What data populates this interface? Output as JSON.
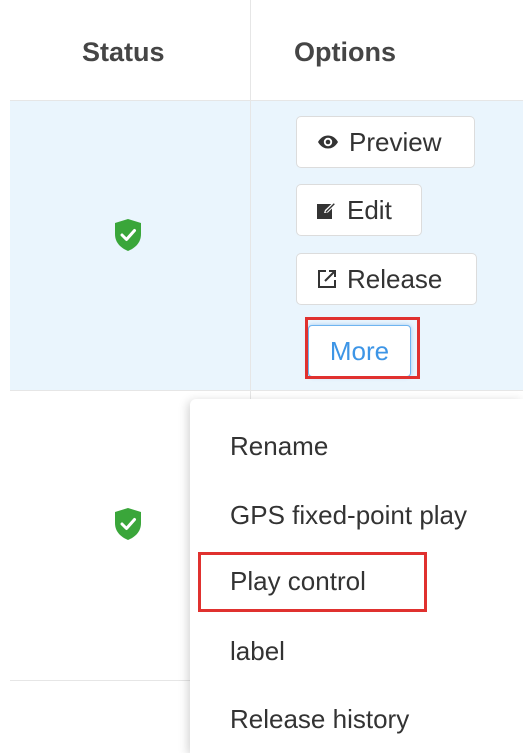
{
  "table": {
    "headers": {
      "status": "Status",
      "options": "Options"
    },
    "rows": [
      {
        "status_icon": "green-shield-check-icon"
      },
      {
        "status_icon": "green-shield-check-icon"
      }
    ]
  },
  "options": {
    "preview": {
      "label": "Preview",
      "icon": "eye-icon"
    },
    "edit": {
      "label": "Edit",
      "icon": "edit-icon"
    },
    "release": {
      "label": "Release",
      "icon": "external-link-icon"
    },
    "more": {
      "label": "More"
    }
  },
  "dropdown": {
    "items": [
      "Rename",
      "GPS fixed-point play",
      "Play control",
      "label",
      "Release history"
    ]
  },
  "colors": {
    "row_highlight_bg": "#eaf5fd",
    "shield_green": "#3aa63a",
    "more_accent": "#3d95e6",
    "annotation_red": "#e0312f"
  }
}
